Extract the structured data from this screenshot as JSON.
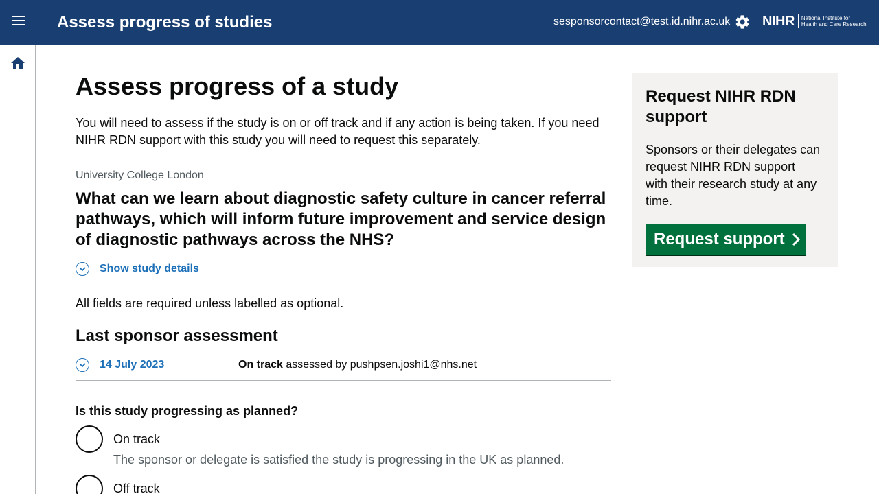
{
  "header": {
    "title": "Assess progress of studies",
    "user_email": "sesponsorcontact@test.id.nihr.ac.uk",
    "logo_main": "NIHR",
    "logo_sub_line1": "National Institute for",
    "logo_sub_line2": "Health and Care Research"
  },
  "icons": {
    "menu": "hamburger-menu-icon",
    "settings": "gear-icon",
    "home": "home-icon"
  },
  "main": {
    "page_title": "Assess progress of a study",
    "intro": "You will need to assess if the study is on or off track and if any action is being taken. If you need NIHR RDN support with this study you will need to request this separately.",
    "organisation": "University College London",
    "study_title": "What can we learn about diagnostic safety culture in cancer referral pathways, which will inform future improvement and service design of diagnostic pathways across the NHS?",
    "show_details": "Show study details",
    "fields_note": "All fields are required unless labelled as optional.",
    "last_assessment_heading": "Last sponsor assessment",
    "last_assessment": {
      "date": "14 July 2023",
      "status": "On track",
      "assessed_by_text": " assessed by pushpsen.joshi1@nhs.net"
    },
    "question": "Is this study progressing as planned?",
    "options": [
      {
        "label": "On track",
        "hint": "The sponsor or delegate is satisfied the study is progressing in the UK as planned."
      },
      {
        "label": "Off track",
        "hint": ""
      }
    ]
  },
  "side_panel": {
    "title": "Request NIHR RDN support",
    "text": "Sponsors or their delegates can request NIHR RDN support with their research study at any time.",
    "button_label": "Request support"
  },
  "colors": {
    "header_bg": "#193e72",
    "link": "#1d70b8",
    "button_green": "#00703c",
    "panel_bg": "#f3f2f1"
  }
}
